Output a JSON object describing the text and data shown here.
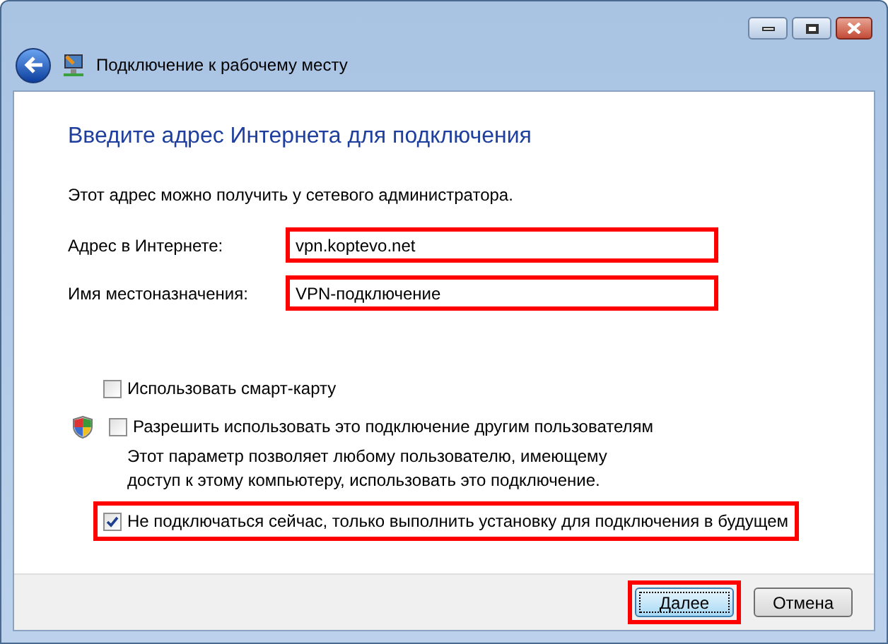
{
  "window": {
    "title": "Подключение к рабочему месту"
  },
  "heading": "Введите адрес Интернета для подключения",
  "intro": "Этот адрес можно получить у сетевого администратора.",
  "fields": [
    {
      "label": "Адрес в Интернете:",
      "value": "vpn.koptevo.net",
      "highlighted": true
    },
    {
      "label": "Имя местоназначения:",
      "value": "VPN-подключение",
      "highlighted": true
    }
  ],
  "options": [
    {
      "label": "Использовать смарт-карту",
      "checked": false,
      "shield": false,
      "highlighted": false
    },
    {
      "label": "Разрешить использовать это подключение другим пользователям",
      "checked": false,
      "shield": true,
      "highlighted": false,
      "description": "Этот параметр позволяет любому пользователю, имеющему доступ к этому компьютеру, использовать это подключение."
    },
    {
      "label": "Не подключаться сейчас, только выполнить установку для подключения в будущем",
      "checked": true,
      "shield": false,
      "highlighted": true
    }
  ],
  "buttons": [
    {
      "label": "Далее",
      "highlighted": true,
      "default": true
    },
    {
      "label": "Отмена",
      "highlighted": false,
      "default": false
    }
  ]
}
